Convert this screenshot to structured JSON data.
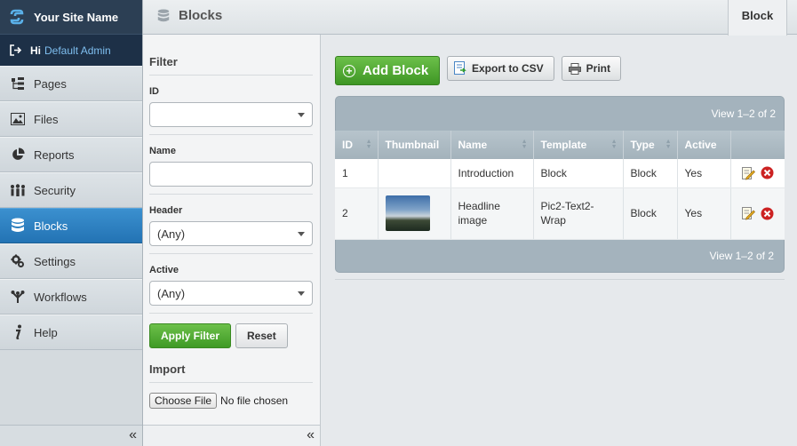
{
  "app": {
    "site_name": "Your Site Name"
  },
  "user": {
    "greeting": "Hi",
    "name": "Default Admin"
  },
  "nav": {
    "items": [
      {
        "label": "Pages",
        "icon": "pages-icon"
      },
      {
        "label": "Files",
        "icon": "files-icon"
      },
      {
        "label": "Reports",
        "icon": "reports-icon"
      },
      {
        "label": "Security",
        "icon": "security-icon"
      },
      {
        "label": "Blocks",
        "icon": "blocks-icon",
        "active": true
      },
      {
        "label": "Settings",
        "icon": "settings-icon"
      },
      {
        "label": "Workflows",
        "icon": "workflows-icon"
      },
      {
        "label": "Help",
        "icon": "help-icon"
      }
    ],
    "collapse": "«"
  },
  "header": {
    "title": "Blocks",
    "tab": "Block"
  },
  "filter": {
    "title": "Filter",
    "id_label": "ID",
    "id_value": "",
    "name_label": "Name",
    "name_value": "",
    "header_label": "Header",
    "header_value": "(Any)",
    "active_label": "Active",
    "active_value": "(Any)",
    "apply": "Apply Filter",
    "reset": "Reset",
    "import_title": "Import",
    "choose_file": "Choose File",
    "no_file": "No file chosen",
    "collapse": "«"
  },
  "toolbar": {
    "add": "Add Block",
    "export": "Export to CSV",
    "print": "Print"
  },
  "grid": {
    "pager_top": "View 1–2 of 2",
    "pager_bottom": "View 1–2 of 2",
    "columns": [
      "ID",
      "Thumbnail",
      "Name",
      "Template",
      "Type",
      "Active"
    ],
    "rows": [
      {
        "id": "1",
        "thumbnail": false,
        "name": "Introduction",
        "template": "Block",
        "type": "Block",
        "active": "Yes"
      },
      {
        "id": "2",
        "thumbnail": true,
        "name": "Headline image",
        "template": "Pic2-Text2-Wrap",
        "type": "Block",
        "active": "Yes"
      }
    ]
  },
  "colors": {
    "sidebar_dark": "#2c3f54",
    "active_nav": "#2373b4",
    "green": "#3f9a25",
    "delete": "#cc2222"
  }
}
